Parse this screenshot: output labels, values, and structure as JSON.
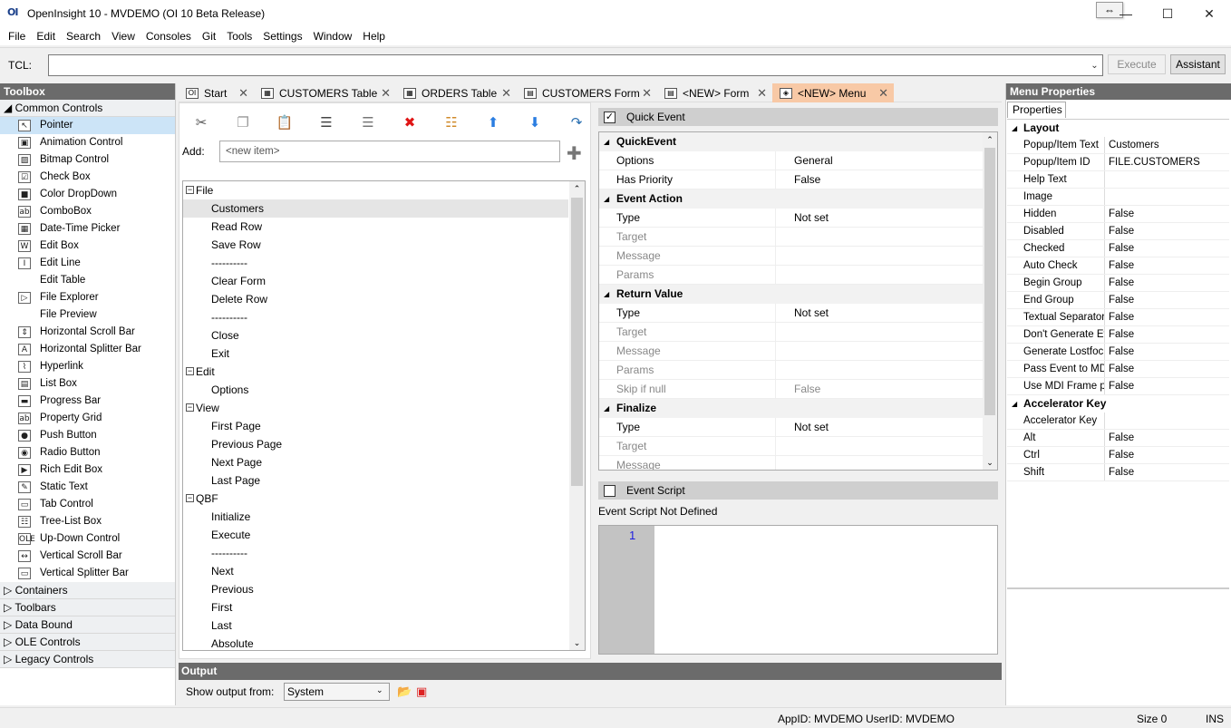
{
  "window": {
    "logo": "OI",
    "title": "OpenInsight 10 - MVDEMO (OI 10 Beta Release)",
    "resize_tooltip": "⇔"
  },
  "menubar": [
    "File",
    "Edit",
    "Search",
    "View",
    "Consoles",
    "Git",
    "Tools",
    "Settings",
    "Window",
    "Help"
  ],
  "tcl": {
    "label": "TCL:",
    "value": "",
    "execute": "Execute",
    "assistant": "Assistant"
  },
  "toolbox": {
    "title": "Toolbox",
    "group_open": "Common Controls",
    "items": [
      {
        "label": "Pointer",
        "icon": "pointer-icon",
        "glyph": "↖"
      },
      {
        "label": "Animation Control",
        "icon": "animation-icon",
        "glyph": "▣"
      },
      {
        "label": "Bitmap Control",
        "icon": "bitmap-icon",
        "glyph": "▨"
      },
      {
        "label": "Check Box",
        "icon": "checkbox-icon",
        "glyph": "☑"
      },
      {
        "label": "Color DropDown",
        "icon": "color-dropdown-icon",
        "glyph": "■"
      },
      {
        "label": "ComboBox",
        "icon": "combobox-icon",
        "glyph": "ab"
      },
      {
        "label": "Date-Time Picker",
        "icon": "datetime-icon",
        "glyph": "▦"
      },
      {
        "label": "Edit Box",
        "icon": "editbox-icon",
        "glyph": "W"
      },
      {
        "label": "Edit Line",
        "icon": "editline-icon",
        "glyph": "I"
      },
      {
        "label": "Edit Table",
        "icon": "edittable-icon",
        "glyph": ""
      },
      {
        "label": "File Explorer",
        "icon": "file-explorer-icon",
        "glyph": "▷"
      },
      {
        "label": "File Preview",
        "icon": "file-preview-icon",
        "glyph": ""
      },
      {
        "label": "Horizontal Scroll Bar",
        "icon": "hscroll-icon",
        "glyph": "⇕"
      },
      {
        "label": "Horizontal Splitter Bar",
        "icon": "hsplitter-icon",
        "glyph": "A"
      },
      {
        "label": "Hyperlink",
        "icon": "hyperlink-icon",
        "glyph": "⌇"
      },
      {
        "label": "List Box",
        "icon": "listbox-icon",
        "glyph": "▤"
      },
      {
        "label": "Progress Bar",
        "icon": "progressbar-icon",
        "glyph": "▬"
      },
      {
        "label": "Property Grid",
        "icon": "propertygrid-icon",
        "glyph": "ab"
      },
      {
        "label": "Push Button",
        "icon": "pushbutton-icon",
        "glyph": "●"
      },
      {
        "label": "Radio Button",
        "icon": "radiobutton-icon",
        "glyph": "◉"
      },
      {
        "label": "Rich Edit Box",
        "icon": "richedit-icon",
        "glyph": "▶"
      },
      {
        "label": "Static Text",
        "icon": "statictext-icon",
        "glyph": "✎"
      },
      {
        "label": "Tab Control",
        "icon": "tabcontrol-icon",
        "glyph": "▭"
      },
      {
        "label": "Tree-List Box",
        "icon": "treelist-icon",
        "glyph": "☷"
      },
      {
        "label": "Up-Down Control",
        "icon": "updown-icon",
        "glyph": "OLE"
      },
      {
        "label": "Vertical Scroll Bar",
        "icon": "vscroll-icon",
        "glyph": "↔"
      },
      {
        "label": "Vertical Splitter Bar",
        "icon": "vsplitter-icon",
        "glyph": "▭"
      }
    ],
    "groups_closed": [
      "Containers",
      "Toolbars",
      "Data Bound",
      "OLE Controls",
      "Legacy Controls"
    ]
  },
  "tabs": [
    {
      "label": "Start",
      "icon": "oi-logo-icon",
      "glyph": "OI",
      "active": false
    },
    {
      "label": "CUSTOMERS Table",
      "icon": "table-icon",
      "glyph": "▦",
      "active": false
    },
    {
      "label": "ORDERS Table",
      "icon": "table-icon",
      "glyph": "▦",
      "active": false
    },
    {
      "label": "CUSTOMERS Form",
      "icon": "form-icon",
      "glyph": "▤",
      "active": false
    },
    {
      "label": "<NEW> Form",
      "icon": "form-icon",
      "glyph": "▤",
      "active": false
    },
    {
      "label": "<NEW> Menu",
      "icon": "menu-icon",
      "glyph": "◈",
      "active": true
    }
  ],
  "designer": {
    "toolbar": [
      {
        "name": "cut-icon",
        "glyph": "✂",
        "color": "#555555"
      },
      {
        "name": "copy-icon",
        "glyph": "❐",
        "color": "#999999"
      },
      {
        "name": "paste-icon",
        "glyph": "📋",
        "color": "#999999"
      },
      {
        "name": "indent-icon",
        "glyph": "☰",
        "color": "#444444"
      },
      {
        "name": "outdent-icon",
        "glyph": "☰",
        "color": "#777777"
      },
      {
        "name": "delete-icon",
        "glyph": "✖",
        "color": "#e01515"
      },
      {
        "name": "insert-separator-icon",
        "glyph": "☷",
        "color": "#d08a2a"
      },
      {
        "name": "move-up-icon",
        "glyph": "⬆",
        "color": "#2a7de1"
      },
      {
        "name": "move-down-icon",
        "glyph": "⬇",
        "color": "#2a7de1"
      },
      {
        "name": "redo-icon",
        "glyph": "↷",
        "color": "#2a6fb0"
      }
    ],
    "add_label": "Add:",
    "add_placeholder": "<new item>",
    "tree": [
      {
        "label": "File",
        "level": 0,
        "toggle": "−"
      },
      {
        "label": "Customers",
        "level": 1,
        "selected": true
      },
      {
        "label": "Read Row",
        "level": 1
      },
      {
        "label": "Save Row",
        "level": 1
      },
      {
        "label": "----------",
        "level": 1
      },
      {
        "label": "Clear Form",
        "level": 1
      },
      {
        "label": "Delete Row",
        "level": 1
      },
      {
        "label": "----------",
        "level": 1
      },
      {
        "label": "Close",
        "level": 1
      },
      {
        "label": "Exit",
        "level": 1
      },
      {
        "label": "Edit",
        "level": 0,
        "toggle": "−"
      },
      {
        "label": "Options",
        "level": 1
      },
      {
        "label": "View",
        "level": 0,
        "toggle": "−"
      },
      {
        "label": "First Page",
        "level": 1
      },
      {
        "label": "Previous Page",
        "level": 1
      },
      {
        "label": "Next Page",
        "level": 1
      },
      {
        "label": "Last Page",
        "level": 1
      },
      {
        "label": "QBF",
        "level": 0,
        "toggle": "−"
      },
      {
        "label": "Initialize",
        "level": 1
      },
      {
        "label": "Execute",
        "level": 1
      },
      {
        "label": "----------",
        "level": 1
      },
      {
        "label": "Next",
        "level": 1
      },
      {
        "label": "Previous",
        "level": 1
      },
      {
        "label": "First",
        "level": 1
      },
      {
        "label": "Last",
        "level": 1
      },
      {
        "label": "Absolute",
        "level": 1
      }
    ]
  },
  "quick_event": {
    "checkbox_label": "Quick Event",
    "checked_glyph": "✓",
    "sections": [
      {
        "title": "QuickEvent",
        "rows": [
          {
            "k": "Options",
            "v": "General"
          },
          {
            "k": "Has Priority",
            "v": "False"
          }
        ]
      },
      {
        "title": "Event Action",
        "rows": [
          {
            "k": "Type",
            "v": "Not set"
          },
          {
            "k": "Target",
            "v": "",
            "dim": true
          },
          {
            "k": "Message",
            "v": "",
            "dim": true
          },
          {
            "k": "Params",
            "v": "",
            "dim": true
          }
        ]
      },
      {
        "title": "Return Value",
        "rows": [
          {
            "k": "Type",
            "v": "Not set"
          },
          {
            "k": "Target",
            "v": "",
            "dim": true
          },
          {
            "k": "Message",
            "v": "",
            "dim": true
          },
          {
            "k": "Params",
            "v": "",
            "dim": true
          },
          {
            "k": "Skip if null",
            "v": "False",
            "dim": true
          }
        ]
      },
      {
        "title": "Finalize",
        "rows": [
          {
            "k": "Type",
            "v": "Not set"
          },
          {
            "k": "Target",
            "v": "",
            "dim": true
          },
          {
            "k": "Message",
            "v": "",
            "dim": true
          }
        ]
      }
    ]
  },
  "event_script": {
    "checkbox_label": "Event Script",
    "status": "Event Script Not Defined",
    "line_number": "1"
  },
  "output": {
    "title": "Output",
    "label": "Show output from:",
    "selected": "System"
  },
  "properties": {
    "title": "Menu Properties",
    "tab": "Properties",
    "sections": [
      {
        "title": "Layout",
        "rows": [
          {
            "k": "Popup/Item Text",
            "v": "Customers"
          },
          {
            "k": "Popup/Item ID",
            "v": "FILE.CUSTOMERS"
          },
          {
            "k": "Help Text",
            "v": ""
          },
          {
            "k": "Image",
            "v": ""
          },
          {
            "k": "Hidden",
            "v": "False"
          },
          {
            "k": "Disabled",
            "v": "False"
          },
          {
            "k": "Checked",
            "v": "False"
          },
          {
            "k": "Auto Check",
            "v": "False"
          },
          {
            "k": "Begin Group",
            "v": "False"
          },
          {
            "k": "End Group",
            "v": "False"
          },
          {
            "k": "Textual Separator",
            "v": "False"
          },
          {
            "k": "Don't Generate Event",
            "v": "False"
          },
          {
            "k": "Generate Lostfocus Event",
            "v": "False"
          },
          {
            "k": "Pass Event to MDI Frame",
            "v": "False"
          },
          {
            "k": "Use MDI Frame properties",
            "v": "False"
          }
        ]
      },
      {
        "title": "Accelerator Key",
        "rows": [
          {
            "k": "Accelerator Key",
            "v": ""
          },
          {
            "k": "Alt",
            "v": "False"
          },
          {
            "k": "Ctrl",
            "v": "False"
          },
          {
            "k": "Shift",
            "v": "False"
          }
        ]
      }
    ]
  },
  "statusbar": {
    "appid": "AppID: MVDEMO",
    "userid": "UserID: MVDEMO",
    "size": "Size 0",
    "mode": "INS"
  },
  "colors": {
    "active_tab": "#f8c9a6",
    "selected_toolbox": "#cce4f7",
    "panel_header": "#6b6b6b"
  }
}
